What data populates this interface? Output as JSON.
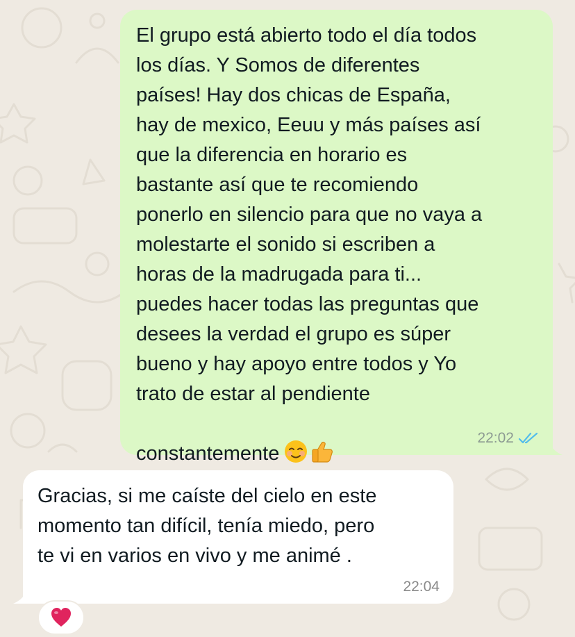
{
  "chat": {
    "messages": [
      {
        "direction": "outgoing",
        "text": "El grupo está abierto todo el día todos\nlos días. Y Somos de diferentes\npaíses! Hay dos chicas de España,\nhay de mexico, Eeuu y más países así\nque la diferencia en horario es\nbastante así que te recomiendo\nponerlo en silencio para que no vaya a\nmolestarte el sonido si escriben a\nhoras de la madrugada para ti...\npuedes hacer todas las preguntas que\ndesees la verdad el grupo es súper\nbueno y hay apoyo entre todos y Yo\ntrato de estar al pendiente\nconstantemente",
        "emojis": [
          "smiling-face-emoji",
          "thumbs-up-emoji"
        ],
        "time": "22:02",
        "status": "read",
        "status_icon": "double-check-icon"
      },
      {
        "direction": "incoming",
        "text": "Gracias, si me caíste del cielo en este\nmomento tan difícil, tenía miedo, pero\nte vi en varios en vivo y me animé .",
        "time": "22:04",
        "reaction": "heart-emoji"
      }
    ]
  },
  "colors": {
    "wallpaper": "#efeae2",
    "outgoing_bubble": "#dcf8c6",
    "incoming_bubble": "#ffffff",
    "read_ticks": "#53bdeb",
    "heart": "#e0245e"
  }
}
